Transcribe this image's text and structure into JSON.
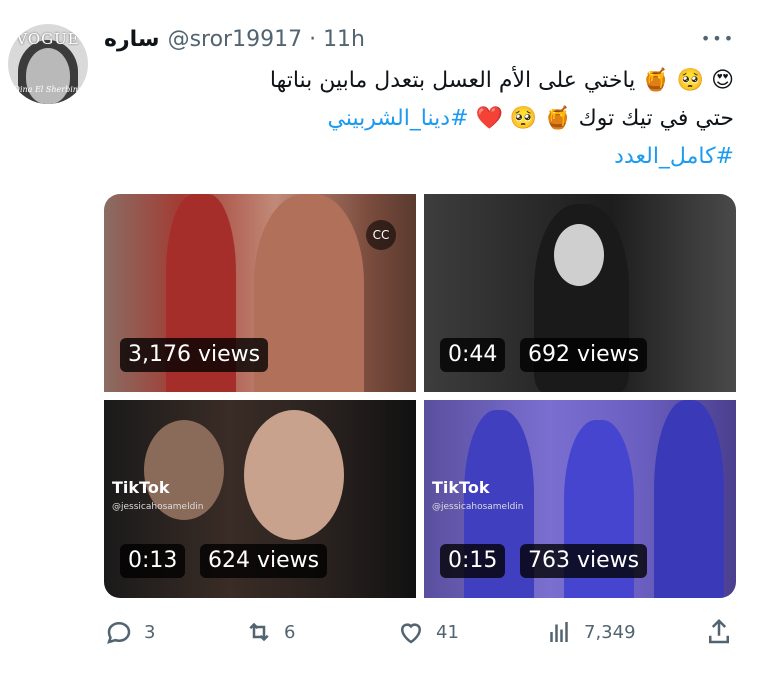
{
  "tweet": {
    "display_name": "ساره",
    "handle": "@sror19917",
    "time": "11h",
    "text_line1": "😍 🥺 🍯 ياختي على الأم العسل بتعدل مابين بناتها",
    "text_line2_plain": "حتي في تيك توك 🍯 🥺 ❤️",
    "text_line2_hashtag": "#دينا_الشربيني",
    "text_line3_hashtag": "#كامل_العدد",
    "avatar_text": "VOGUE",
    "avatar_sig": "Dina El Sherbiny"
  },
  "media": [
    {
      "views": "3,176 views",
      "duration": ""
    },
    {
      "views": "692 views",
      "duration": "0:44"
    },
    {
      "views": "624 views",
      "duration": "0:13",
      "watermark": "TikTok",
      "user": "@jessicahosameldin"
    },
    {
      "views": "763 views",
      "duration": "0:15",
      "watermark": "TikTok",
      "user": "@jessicahosameldin"
    }
  ],
  "actions": {
    "replies": "3",
    "retweets": "6",
    "likes": "41",
    "views": "7,349"
  },
  "colors": {
    "accent": "#1d9bf0",
    "secondary_text": "#536471"
  },
  "icons": [
    "more-icon",
    "reply-icon",
    "retweet-icon",
    "like-icon",
    "analytics-icon",
    "share-icon",
    "captions-icon"
  ]
}
